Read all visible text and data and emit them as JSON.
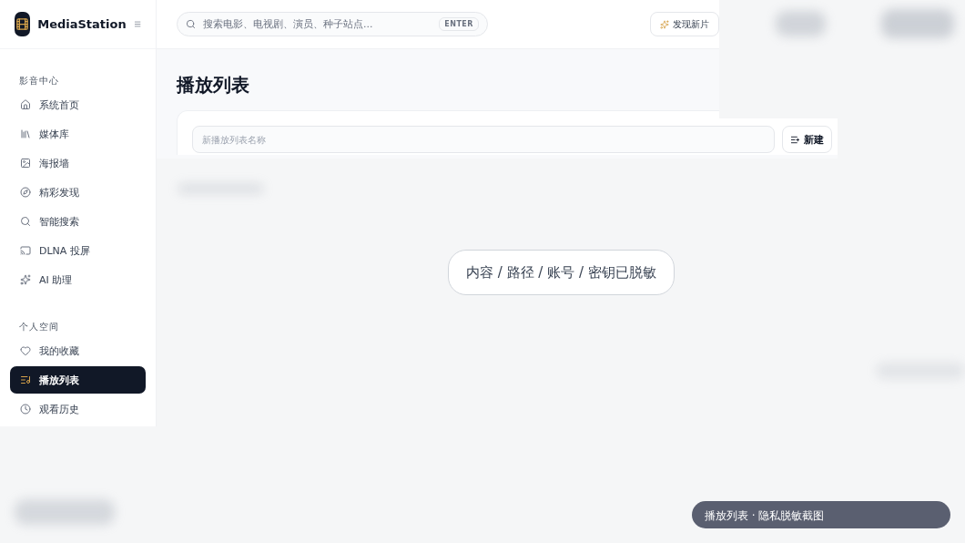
{
  "app": {
    "name": "MediaStation"
  },
  "search": {
    "placeholder": "搜索电影、电视剧、演员、种子站点...",
    "shortcut": "ENTER"
  },
  "discover_button": {
    "label": "发现新片"
  },
  "sidebar": {
    "sections": [
      {
        "title": "影音中心",
        "items": [
          {
            "label": "系统首页",
            "selected": false
          },
          {
            "label": "媒体库",
            "selected": false
          },
          {
            "label": "海报墙",
            "selected": false
          },
          {
            "label": "精彩发现",
            "selected": false
          },
          {
            "label": "智能搜索",
            "selected": false
          },
          {
            "label": "DLNA 投屏",
            "selected": false
          },
          {
            "label": "AI 助理",
            "selected": false
          }
        ]
      },
      {
        "title": "个人空间",
        "items": [
          {
            "label": "我的收藏",
            "selected": false
          },
          {
            "label": "播放列表",
            "selected": true
          },
          {
            "label": "观看历史",
            "selected": false
          }
        ]
      }
    ]
  },
  "page": {
    "title": "播放列表",
    "new_playlist": {
      "placeholder": "新播放列表名称",
      "button": "新建"
    }
  },
  "notice": "内容 / 路径 / 账号 / 密钥已脱敏",
  "caption": "播放列表 · 隐私脱敏截图"
}
